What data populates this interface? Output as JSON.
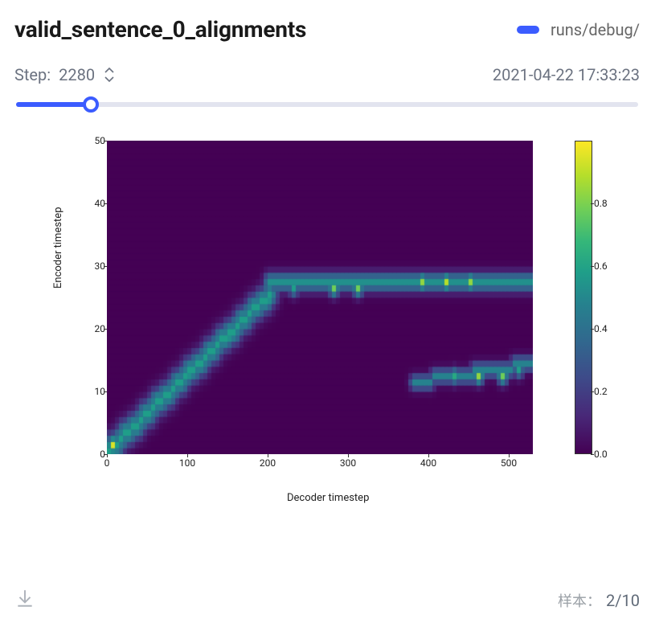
{
  "header": {
    "title": "valid_sentence_0_alignments",
    "run_name": "runs/debug/",
    "run_color": "#3b5cff"
  },
  "step": {
    "prefix": "Step:",
    "value": "2280",
    "timestamp": "2021-04-22 17:33:23",
    "slider_fraction": 0.12
  },
  "chart_data": {
    "type": "heatmap",
    "xlabel": "Decoder timestep",
    "ylabel": "Encoder timestep",
    "xlim": [
      0,
      530
    ],
    "ylim": [
      0,
      50
    ],
    "colorbar": {
      "min": 0.0,
      "max": 1.0,
      "ticks": [
        0.0,
        0.2,
        0.4,
        0.6,
        0.8
      ],
      "colormap": "viridis"
    },
    "x_ticks": [
      0,
      100,
      200,
      300,
      400,
      500
    ],
    "y_ticks": [
      0,
      10,
      20,
      30,
      40,
      50
    ],
    "bands": [
      {
        "kind": "diag",
        "x0": 0,
        "x1": 200,
        "y0": 0,
        "y1": 25,
        "width": 2.0,
        "intensity": 0.6
      },
      {
        "kind": "flat",
        "x0": 200,
        "x1": 530,
        "y": 26.5,
        "width": 1.5,
        "intensity": 0.55
      },
      {
        "kind": "diag",
        "x0": 380,
        "x1": 530,
        "y0": 11,
        "y1": 14,
        "width": 1.2,
        "intensity": 0.5
      }
    ],
    "hotspots": [
      {
        "x": 5,
        "y": 1,
        "v": 0.95
      },
      {
        "x": 20,
        "y": 3,
        "v": 0.6
      },
      {
        "x": 50,
        "y": 6,
        "v": 0.55
      },
      {
        "x": 100,
        "y": 12,
        "v": 0.55
      },
      {
        "x": 150,
        "y": 18,
        "v": 0.55
      },
      {
        "x": 200,
        "y": 24,
        "v": 0.55
      },
      {
        "x": 230,
        "y": 26,
        "v": 0.6
      },
      {
        "x": 280,
        "y": 26,
        "v": 0.8
      },
      {
        "x": 310,
        "y": 26,
        "v": 0.8
      },
      {
        "x": 350,
        "y": 27,
        "v": 0.55
      },
      {
        "x": 390,
        "y": 27,
        "v": 0.85
      },
      {
        "x": 420,
        "y": 27,
        "v": 0.9
      },
      {
        "x": 450,
        "y": 27,
        "v": 0.85
      },
      {
        "x": 500,
        "y": 27,
        "v": 0.5
      },
      {
        "x": 430,
        "y": 12,
        "v": 0.65
      },
      {
        "x": 460,
        "y": 12,
        "v": 0.85
      },
      {
        "x": 490,
        "y": 12,
        "v": 0.8
      },
      {
        "x": 510,
        "y": 13,
        "v": 0.6
      },
      {
        "x": 400,
        "y": 11,
        "v": 0.35
      }
    ]
  },
  "footer": {
    "sample_label": "样本：",
    "sample_current": "2",
    "sample_sep": "/",
    "sample_total": "10"
  }
}
